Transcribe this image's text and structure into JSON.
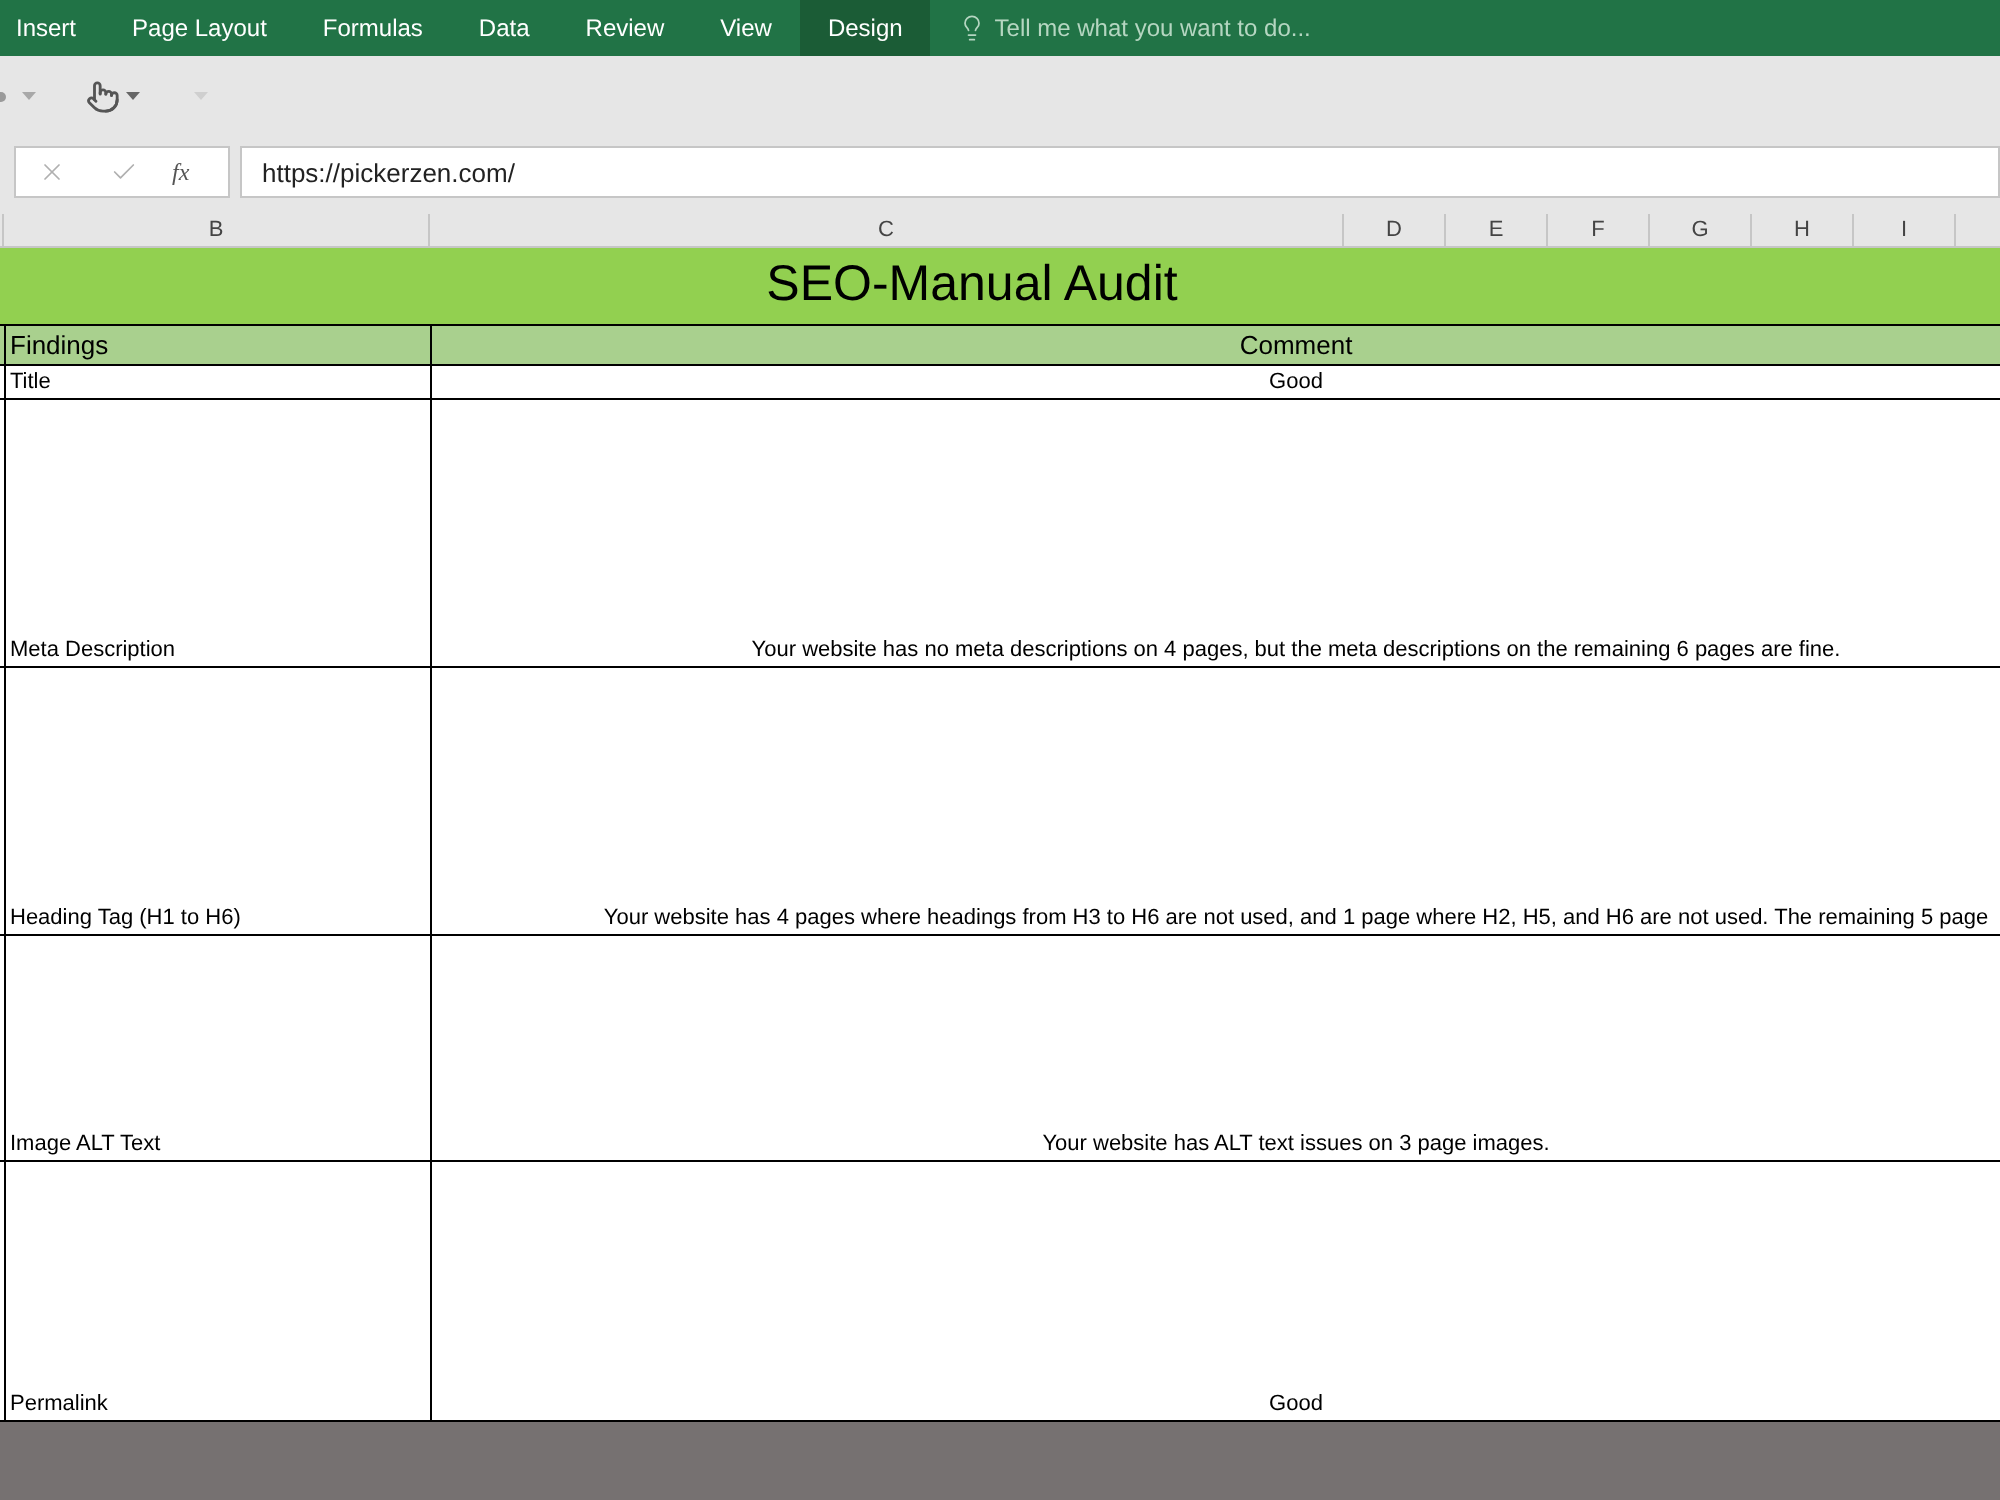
{
  "ribbon": {
    "tabs": [
      {
        "label": "Insert",
        "selected": false
      },
      {
        "label": "Page Layout",
        "selected": false
      },
      {
        "label": "Formulas",
        "selected": false
      },
      {
        "label": "Data",
        "selected": false
      },
      {
        "label": "Review",
        "selected": false
      },
      {
        "label": "View",
        "selected": false
      },
      {
        "label": "Design",
        "selected": true
      }
    ],
    "tell_me": {
      "placeholder": "Tell me what you want to do..."
    }
  },
  "formula_bar": {
    "function_label": "fx",
    "value": "https://pickerzen.com/"
  },
  "column_headers": [
    "B",
    "C",
    "D",
    "E",
    "F",
    "G",
    "H",
    "I"
  ],
  "sheet": {
    "title": "SEO-Manual Audit",
    "header": {
      "findings": "Findings",
      "comment": "Comment"
    },
    "rows": [
      {
        "finding": "Title",
        "comment": "Good"
      },
      {
        "finding": "Meta Description",
        "comment": "Your website has no meta descriptions on 4 pages, but the meta descriptions on the remaining 6 pages are fine."
      },
      {
        "finding": "Heading Tag (H1 to H6)",
        "comment": "Your website has 4 pages where headings from H3 to H6 are not used, and 1 page where H2, H5, and H6 are not used. The remaining 5 page"
      },
      {
        "finding": "Image ALT Text",
        "comment": "Your website has ALT text issues on 3 page images."
      },
      {
        "finding": "Permalink",
        "comment": "Good"
      }
    ]
  }
}
